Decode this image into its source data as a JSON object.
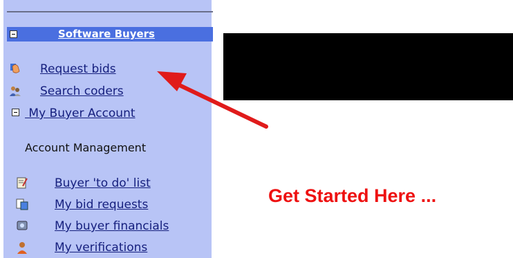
{
  "sidebar": {
    "section_title": "Software Buyers",
    "buyer_links": [
      {
        "label": "Request bids",
        "icon": "hand-pointer-icon"
      },
      {
        "label": "Search coders",
        "icon": "people-search-icon"
      }
    ],
    "account_toggle_label": " My Buyer Account",
    "account_management_heading": "Account Management",
    "account_links": [
      {
        "label": "Buyer 'to do' list",
        "icon": "todo-list-icon"
      },
      {
        "label": "My bid requests",
        "icon": "bid-requests-icon"
      },
      {
        "label": "My buyer financials",
        "icon": "financials-icon"
      },
      {
        "label": "My verifications",
        "icon": "verifications-icon"
      }
    ]
  },
  "main": {
    "callout_text": "Get Started Here ..."
  },
  "colors": {
    "sidebar_bg": "#b8c4f6",
    "header_bg": "#4a6fe0",
    "link": "#16207e",
    "callout": "#ee1111",
    "arrow": "#e01b1b"
  }
}
